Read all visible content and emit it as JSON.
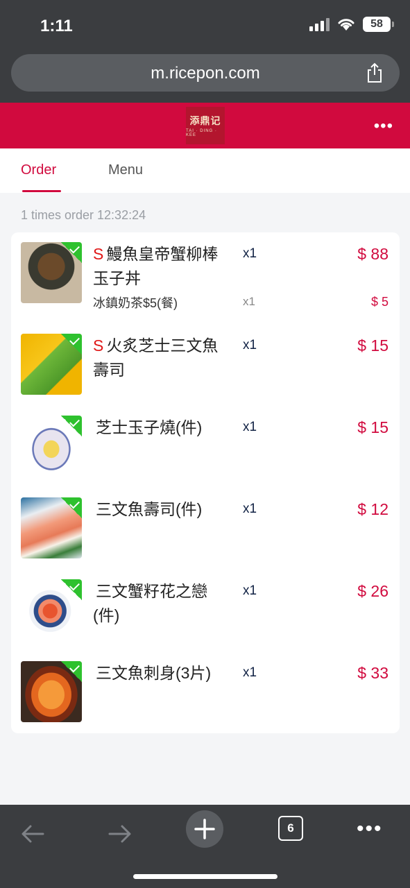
{
  "status_bar": {
    "time": "1:11",
    "battery": "58"
  },
  "browser": {
    "url": "m.ricepon.com",
    "tab_count": "6"
  },
  "brand": {
    "logo_main": "添鼎记",
    "logo_sub": "TAI · DING · KEE"
  },
  "tabs": [
    {
      "label": "Order"
    },
    {
      "label": "Menu"
    }
  ],
  "order": {
    "info": "1 times order 12:32:24"
  },
  "items": [
    {
      "prefix": "S",
      "name": "鰻魚皇帝蟹柳棒玉子丼",
      "qty": "x1",
      "price": "$ 88",
      "addon": {
        "name": "冰鎮奶茶$5(餐)",
        "qty": "x1",
        "price": "$ 5"
      }
    },
    {
      "prefix": "S",
      "name": "火炙芝士三文魚壽司",
      "qty": "x1",
      "price": "$ 15"
    },
    {
      "prefix": "",
      "name": "芝士玉子燒(件)",
      "qty": "x1",
      "price": "$ 15"
    },
    {
      "prefix": "",
      "name": "三文魚壽司(件)",
      "qty": "x1",
      "price": "$ 12"
    },
    {
      "prefix": "",
      "name": "三文蟹籽花之戀(件)",
      "qty": "x1",
      "price": "$ 26"
    },
    {
      "prefix": "",
      "name": "三文魚刺身(3片)",
      "qty": "x1",
      "price": "$ 33"
    }
  ],
  "colors": {
    "brand": "#d10a3e",
    "chrome": "#3b3d40",
    "check": "#2ec12e"
  }
}
